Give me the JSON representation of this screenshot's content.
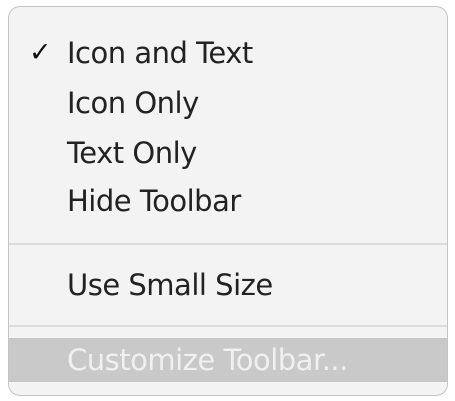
{
  "menu": {
    "checkmark": "✓",
    "items": [
      {
        "label": "Icon and Text",
        "checked": true
      },
      {
        "label": "Icon Only",
        "checked": false
      },
      {
        "label": "Text Only",
        "checked": false
      },
      {
        "label": "Hide Toolbar",
        "checked": false
      },
      {
        "label": "Use Small Size",
        "checked": false
      },
      {
        "label": "Customize Toolbar...",
        "checked": false,
        "highlighted": true
      }
    ]
  },
  "colors": {
    "menu_background": "#f3f3f3",
    "highlight_background": "#c9c9c9",
    "highlight_text": "#f0f0f0",
    "text": "#222222",
    "separator": "#dcdcdc"
  }
}
